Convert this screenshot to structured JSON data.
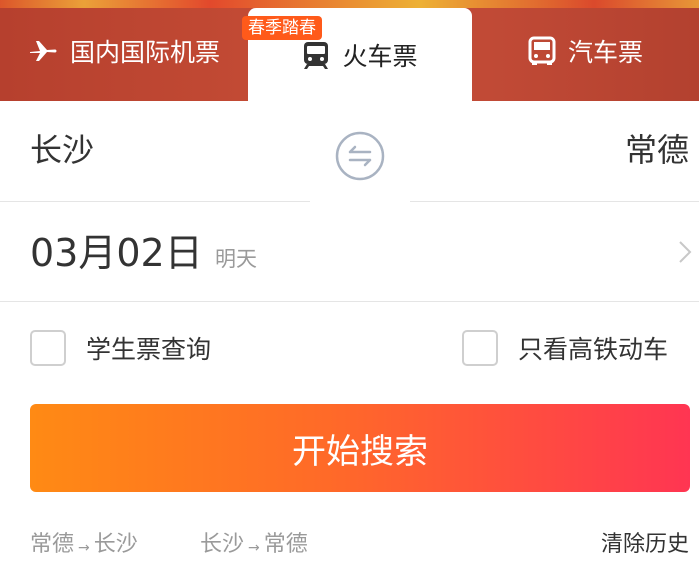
{
  "tabs": {
    "flight": {
      "label": "国内国际机票",
      "icon": "airplane-icon"
    },
    "train": {
      "label": "火车票",
      "icon": "train-icon",
      "badge": "春季踏春"
    },
    "bus": {
      "label": "汽车票",
      "icon": "bus-icon"
    }
  },
  "route": {
    "from": "长沙",
    "to": "常德",
    "swap_icon": "swap-arrows-icon"
  },
  "date": {
    "value": "03月02日",
    "hint": "明天"
  },
  "options": {
    "student_label": "学生票查询",
    "student_checked": false,
    "hsr_label": "只看高铁动车",
    "hsr_checked": false
  },
  "search": {
    "label": "开始搜索"
  },
  "history": {
    "items": [
      {
        "from": "常德",
        "to": "长沙"
      },
      {
        "from": "长沙",
        "to": "常德"
      }
    ],
    "arrow": "→",
    "clear_label": "清除历史"
  },
  "colors": {
    "accent_start": "#ff8a14",
    "accent_end": "#ff3552",
    "tab_bar": "#c14a36",
    "badge": "#ff5a1a"
  }
}
